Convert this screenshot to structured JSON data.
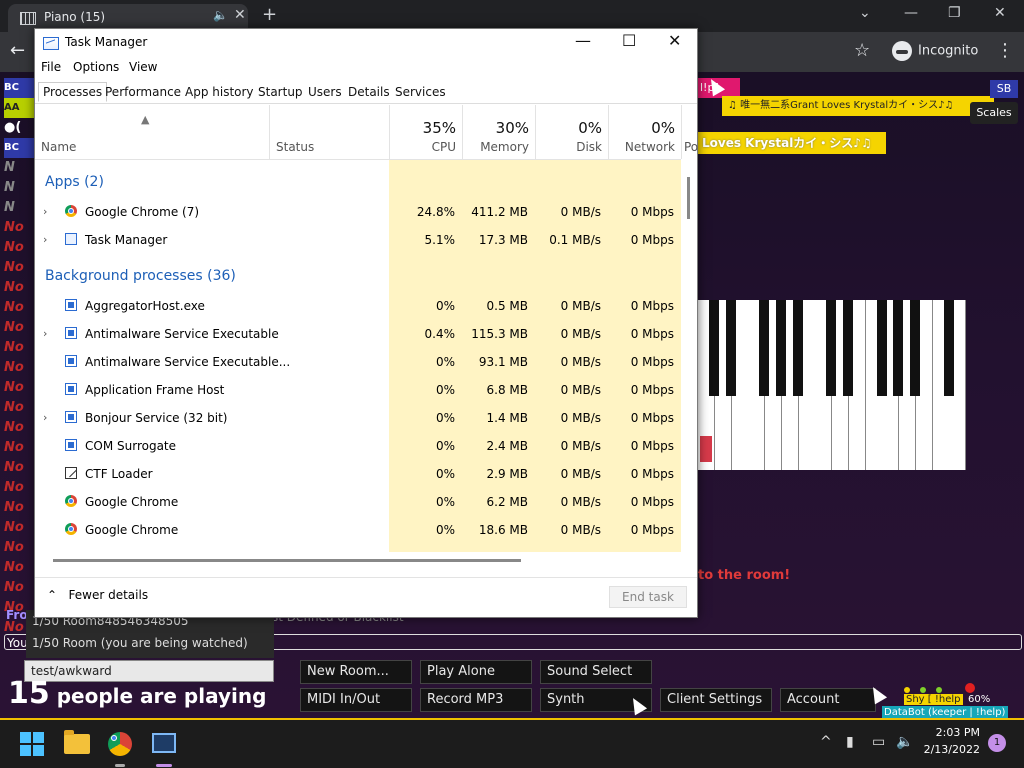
{
  "browser": {
    "tab_title": "Piano (15)",
    "tab_close": "✕",
    "new_tab": "+",
    "incognito_label": "Incognito",
    "minimize": "—",
    "restore": "❐",
    "close": "✕",
    "back": "←",
    "star": "☆",
    "menu": "⋮"
  },
  "piano": {
    "chat_fragments": [
      "BC",
      "AA",
      "●(",
      "BC",
      "N",
      "N",
      "N",
      "No",
      "No",
      "No",
      "No",
      "No",
      "No",
      "No",
      "No",
      "No",
      "No",
      "No",
      "No",
      "No",
      "No",
      "No",
      "No",
      "No",
      "No",
      "No",
      "No",
      "No"
    ],
    "help_chip": "l!p]",
    "banner_top": "♫ 唯一無二系Grant Loves Krystalカイ・シス♪♫",
    "banner_second": "Loves Krystalカイ・シス♪♫",
    "scales": "Scales",
    "sb_chip": "SB",
    "room_notice": "to the room!",
    "partial_text": "Fro",
    "partial_text2": "st Defined or Blacklist",
    "you_fragment": "You",
    "room_list": [
      "1/50 Room848546348505",
      "1/50 Room (you are being watched)"
    ],
    "chat_input": "test/awkward",
    "playing_count": "15",
    "playing_text": "people are playing",
    "buttons_row1": [
      "New Room...",
      "Play Alone",
      "Sound Select"
    ],
    "buttons_row2": [
      "MIDI In/Out",
      "Record MP3",
      "Synth",
      "Client Settings",
      "Account"
    ],
    "databot": "DataBot (keeper | !help)",
    "shy_chip": "Shy [ !help",
    "percent": "60%"
  },
  "taskmanager": {
    "title": "Task Manager",
    "caption_min": "—",
    "caption_max": "☐",
    "caption_close": "✕",
    "menu": [
      "File",
      "Options",
      "View"
    ],
    "tabs": [
      "Processes",
      "Performance",
      "App history",
      "Startup",
      "Users",
      "Details",
      "Services"
    ],
    "columns": {
      "name": "Name",
      "status": "Status",
      "cpu_pct": "35%",
      "cpu": "CPU",
      "mem_pct": "30%",
      "mem": "Memory",
      "disk_pct": "0%",
      "disk": "Disk",
      "net_pct": "0%",
      "net": "Network",
      "extra": "Po"
    },
    "group_apps": "Apps (2)",
    "group_bg": "Background processes (36)",
    "apps": [
      {
        "name": "Google Chrome (7)",
        "cpu": "24.8%",
        "mem": "411.2 MB",
        "disk": "0 MB/s",
        "net": "0 Mbps",
        "icon": "chrome-icon",
        "expand": "›"
      },
      {
        "name": "Task Manager",
        "cpu": "5.1%",
        "mem": "17.3 MB",
        "disk": "0.1 MB/s",
        "net": "0 Mbps",
        "icon": "taskmanager-icon",
        "expand": "›"
      }
    ],
    "background": [
      {
        "name": "AggregatorHost.exe",
        "cpu": "0%",
        "mem": "0.5 MB",
        "disk": "0 MB/s",
        "net": "0 Mbps",
        "icon": "window-icon",
        "expand": ""
      },
      {
        "name": "Antimalware Service Executable",
        "cpu": "0.4%",
        "mem": "115.3 MB",
        "disk": "0 MB/s",
        "net": "0 Mbps",
        "icon": "window-icon",
        "expand": "›"
      },
      {
        "name": "Antimalware Service Executable...",
        "cpu": "0%",
        "mem": "93.1 MB",
        "disk": "0 MB/s",
        "net": "0 Mbps",
        "icon": "window-icon",
        "expand": ""
      },
      {
        "name": "Application Frame Host",
        "cpu": "0%",
        "mem": "6.8 MB",
        "disk": "0 MB/s",
        "net": "0 Mbps",
        "icon": "window-icon",
        "expand": ""
      },
      {
        "name": "Bonjour Service (32 bit)",
        "cpu": "0%",
        "mem": "1.4 MB",
        "disk": "0 MB/s",
        "net": "0 Mbps",
        "icon": "window-icon",
        "expand": "›"
      },
      {
        "name": "COM Surrogate",
        "cpu": "0%",
        "mem": "2.4 MB",
        "disk": "0 MB/s",
        "net": "0 Mbps",
        "icon": "window-icon",
        "expand": ""
      },
      {
        "name": "CTF Loader",
        "cpu": "0%",
        "mem": "2.9 MB",
        "disk": "0 MB/s",
        "net": "0 Mbps",
        "icon": "pen-icon",
        "expand": ""
      },
      {
        "name": "Google Chrome",
        "cpu": "0%",
        "mem": "6.2 MB",
        "disk": "0 MB/s",
        "net": "0 Mbps",
        "icon": "chrome-icon",
        "expand": ""
      },
      {
        "name": "Google Chrome",
        "cpu": "0%",
        "mem": "18.6 MB",
        "disk": "0 MB/s",
        "net": "0 Mbps",
        "icon": "chrome-icon",
        "expand": ""
      }
    ],
    "fewer_details": "Fewer details",
    "end_task": "End task"
  },
  "taskbar": {
    "time": "2:03 PM",
    "date": "2/13/2022",
    "notifications": "1",
    "tray_chevron": "^"
  },
  "colors": {
    "accent_blue": "#1d5fb7",
    "cpu_shade": "#fff4c4",
    "highlight_row": "#e5f0fb",
    "banner_yellow": "#f5d400"
  }
}
